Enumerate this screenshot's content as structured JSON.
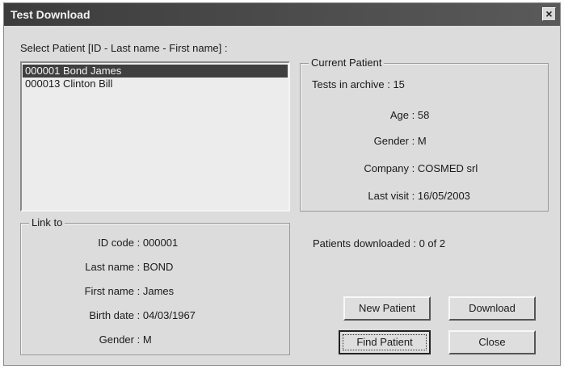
{
  "window": {
    "title": "Test Download",
    "close_glyph": "×"
  },
  "select_label": "Select Patient [ID - Last name - First name] :",
  "patients": [
    {
      "label": "000001 Bond James",
      "selected": true
    },
    {
      "label": "000013 Clinton Bill",
      "selected": false
    }
  ],
  "current_patient": {
    "title": "Current Patient",
    "fields": [
      {
        "label": "Tests in archive",
        "sep": " : ",
        "value": "15"
      },
      {
        "label": "Age",
        "sep": " : ",
        "value": "58"
      },
      {
        "label": "Gender",
        "sep": " : ",
        "value": "M"
      },
      {
        "label": "Company",
        "sep": " : ",
        "value": "COSMED srl"
      },
      {
        "label": "Last visit",
        "sep": " : ",
        "value": "16/05/2003"
      }
    ]
  },
  "link_to": {
    "title": "Link to",
    "fields": [
      {
        "label": "ID code",
        "sep": " : ",
        "value": "000001"
      },
      {
        "label": "Last name",
        "sep": " : ",
        "value": "BOND"
      },
      {
        "label": "First name",
        "sep": " : ",
        "value": "James"
      },
      {
        "label": "Birth date",
        "sep": " : ",
        "value": "04/03/1967"
      },
      {
        "label": "Gender",
        "sep": " : ",
        "value": "M"
      }
    ]
  },
  "status": {
    "downloaded_label": "Patients downloaded :",
    "downloaded_value": "0 of 2"
  },
  "buttons": {
    "new_patient": "New Patient",
    "download": "Download",
    "find_patient": "Find Patient",
    "close": "Close"
  }
}
